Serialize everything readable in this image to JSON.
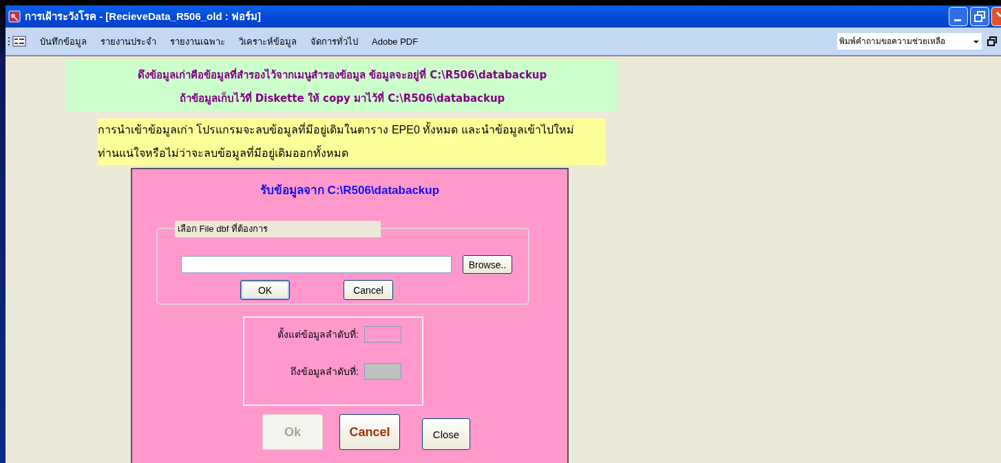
{
  "window": {
    "title": "การเฝ้าระวังโรค - [RecieveData_R506_old : ฟอร์ม]"
  },
  "menu": [
    {
      "label": "บันทึกข้อมูล"
    },
    {
      "label": "รายงานประจำ"
    },
    {
      "label": "รายงานเฉพาะ"
    },
    {
      "label": "วิเคราะห์ข้อมูล"
    },
    {
      "label": "จัดการทั่วไป"
    },
    {
      "label": "Adobe PDF"
    }
  ],
  "help_box": {
    "placeholder": "พิมพ์คำถามขอความช่วยเหลือ"
  },
  "notice": [
    "ดึงข้อมูลเก่าคือข้อมูลที่สำรองไว้จากเมนูสำรองข้อมูล ข้อมูลจะอยู่ที่ C:\\R506\\databackup",
    "ถ้าข้อมูลเก็บไว้ที่ Diskette ให้ copy มาไว้ที่ C:\\R506\\databackup"
  ],
  "warning": "การนำเข้าข้อมูลเก่า โปรแกรมจะลบข้อมูลที่มีอยู่เดิมในตาราง EPE0 ทั้งหมด และนำข้อมูลเข้าไปใหม่ ท่านแน่ใจหรือไม่ว่าจะลบข้อมูลที่มีอยู่เดิมออกทั้งหมด",
  "form": {
    "title": "รับข้อมูลจาก C:\\R506\\databackup",
    "file_group": {
      "label": "เลือก File dbf ที่ต้องการ",
      "browse": "Browse..",
      "buttons": [
        {
          "label": "OK",
          "default": true
        },
        {
          "label": "Cancel",
          "default": false
        }
      ]
    },
    "range_fields": [
      {
        "label": "ตั้งแต่ข้อมูลลำดับที่:",
        "disabled": false
      },
      {
        "label": "ถึงข้อมูลลำดับที่:",
        "disabled": true
      }
    ],
    "buttons": [
      {
        "label": "Ok",
        "kind": "bold",
        "disabled": true
      },
      {
        "label": "Cancel",
        "kind": "bold",
        "disabled": false
      },
      {
        "label": "Close",
        "kind": "plain",
        "disabled": false
      }
    ]
  }
}
